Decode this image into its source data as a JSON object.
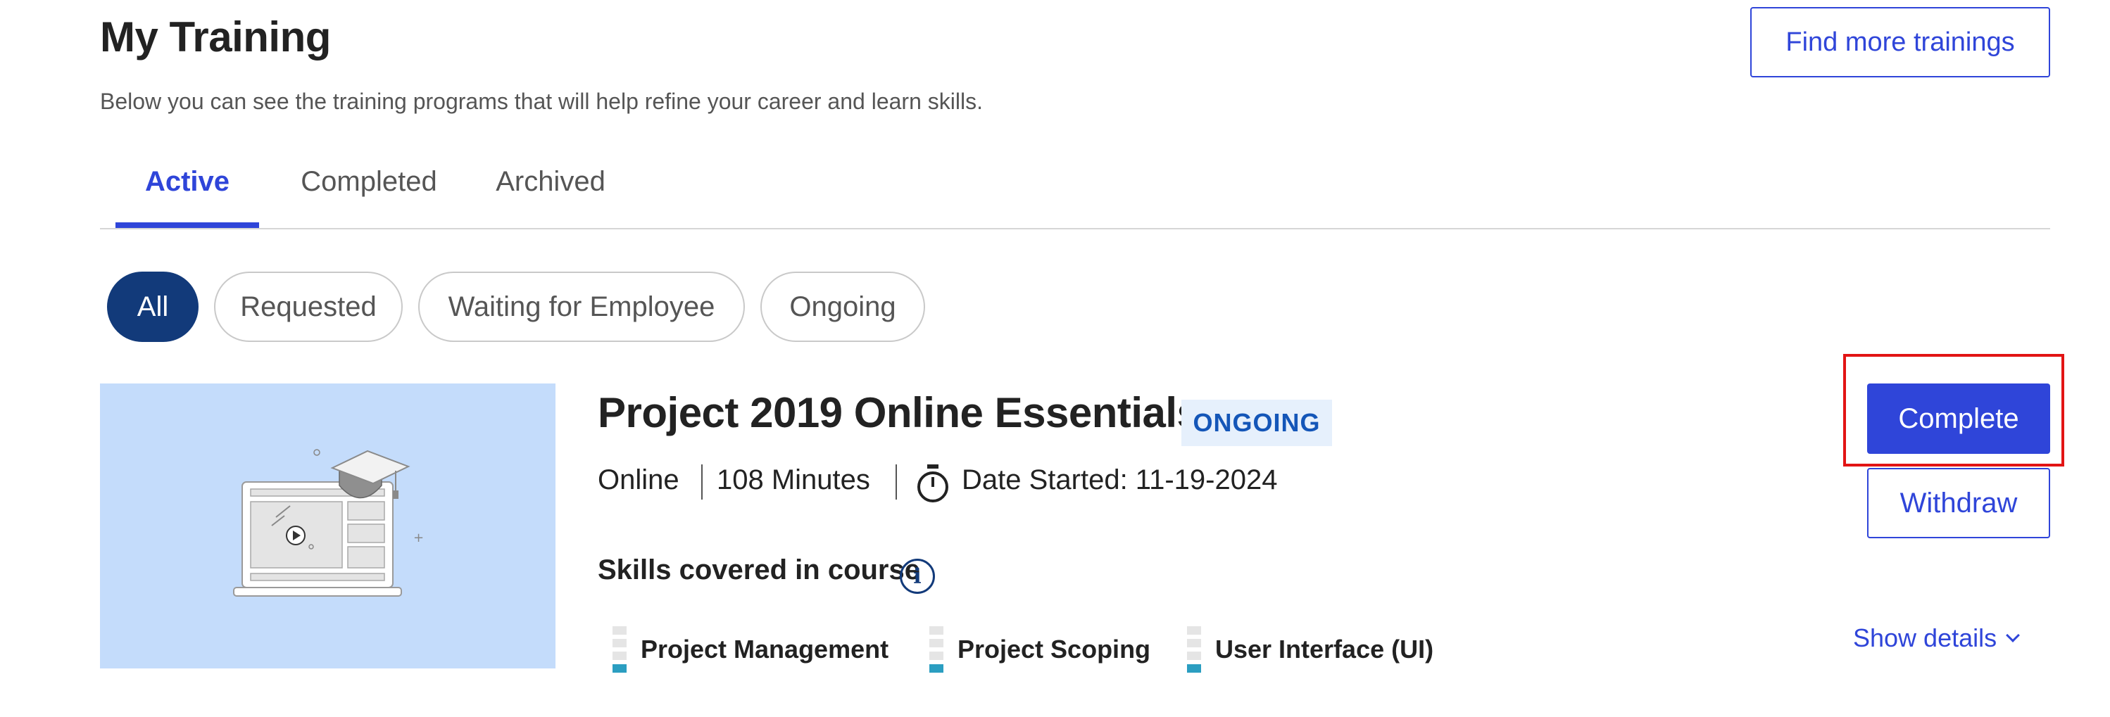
{
  "header": {
    "title": "My Training",
    "subtitle": "Below you can see the training programs that will help refine your career and learn skills.",
    "find_more_label": "Find more trainings"
  },
  "tabs": [
    {
      "label": "Active",
      "active": true
    },
    {
      "label": "Completed",
      "active": false
    },
    {
      "label": "Archived",
      "active": false
    }
  ],
  "filters": [
    {
      "label": "All",
      "active": true
    },
    {
      "label": "Requested",
      "active": false
    },
    {
      "label": "Waiting for Employee",
      "active": false
    },
    {
      "label": "Ongoing",
      "active": false
    }
  ],
  "course": {
    "thumbnail_icon": "laptop-graduation-cap-illustration",
    "title": "Project 2019 Online Essentials",
    "status": "ONGOING",
    "format": "Online",
    "duration": "108 Minutes",
    "date_started": "Date Started: 11-19-2024",
    "skills_heading": "Skills covered in course",
    "skills": [
      {
        "name": "Project Management",
        "level": 1,
        "max_level": 4
      },
      {
        "name": "Project Scoping",
        "level": 1,
        "max_level": 4
      },
      {
        "name": "User Interface (UI)",
        "level": 1,
        "max_level": 4
      }
    ],
    "complete_label": "Complete",
    "withdraw_label": "Withdraw",
    "show_details_label": "Show details"
  },
  "colors": {
    "primary": "#2f45d9",
    "filter_active": "#123a7a",
    "badge_bg": "#e6f0fc",
    "badge_text": "#1456b8",
    "thumbnail_bg": "#c4dcfb",
    "skill_level": "#2b9ec1",
    "highlight": "#e21414"
  }
}
